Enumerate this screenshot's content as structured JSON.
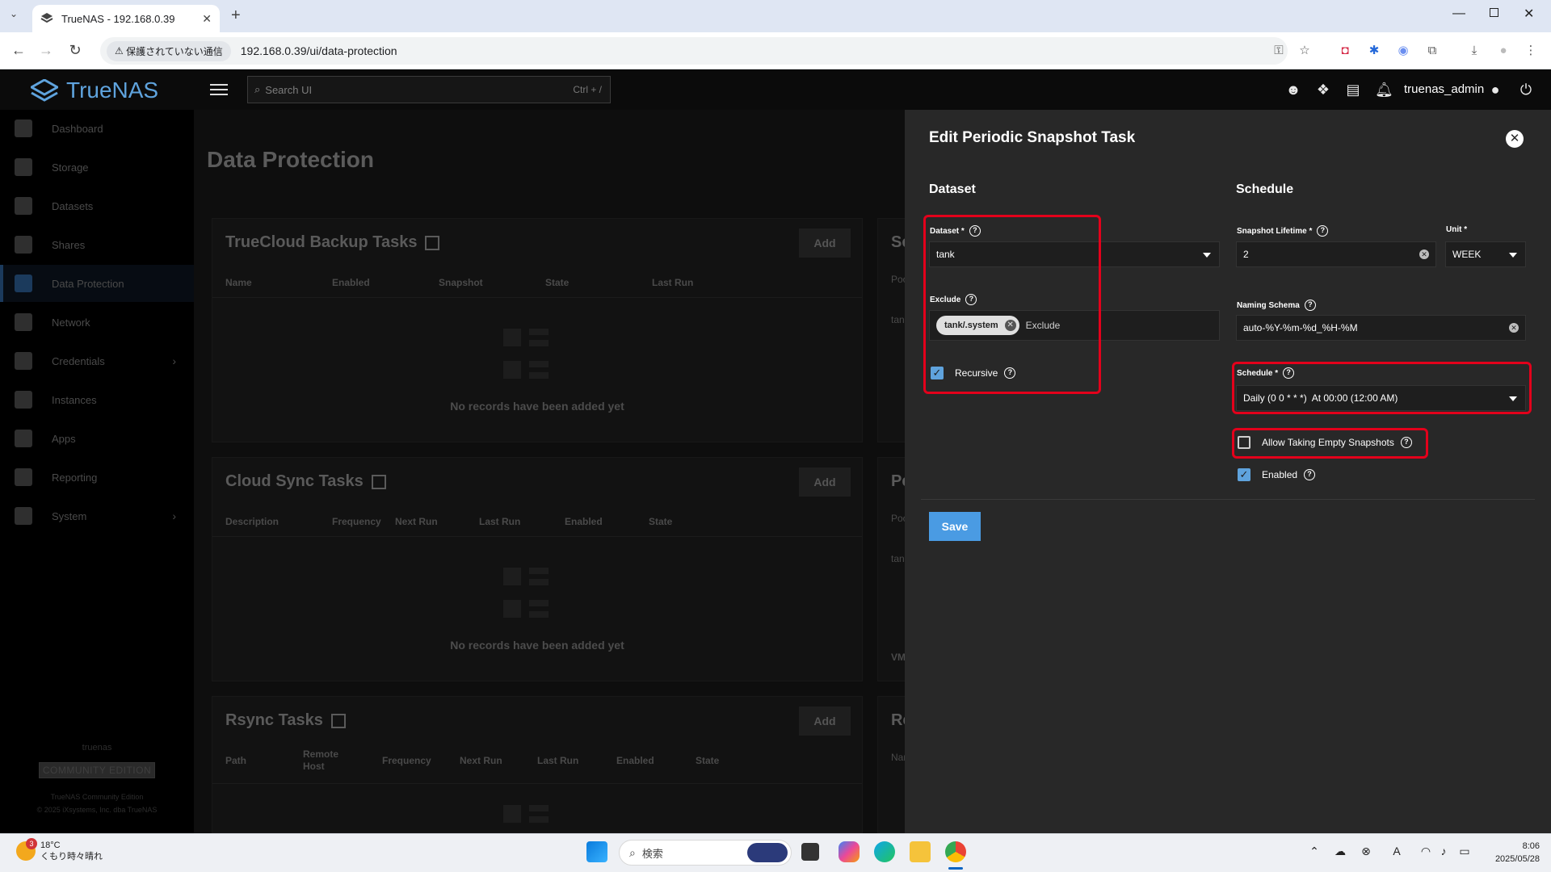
{
  "browser": {
    "tab_title": "TrueNAS - 192.168.0.39",
    "security_warning": "保護されていない通信",
    "url": "192.168.0.39/ui/data-protection"
  },
  "header": {
    "logo_text": "TrueNAS",
    "search_placeholder": "Search UI",
    "search_shortcut": "Ctrl + /",
    "username": "truenas_admin"
  },
  "sidebar": {
    "items": [
      {
        "label": "Dashboard"
      },
      {
        "label": "Storage"
      },
      {
        "label": "Datasets"
      },
      {
        "label": "Shares"
      },
      {
        "label": "Data Protection"
      },
      {
        "label": "Network"
      },
      {
        "label": "Credentials"
      },
      {
        "label": "Instances"
      },
      {
        "label": "Apps"
      },
      {
        "label": "Reporting"
      },
      {
        "label": "System"
      }
    ],
    "hostname": "truenas",
    "edition": "COMMUNITY EDITION",
    "version": "TrueNAS Community Edition",
    "copyright": "© 2025 iXsystems, Inc. dba TrueNAS"
  },
  "main": {
    "page_title": "Data Protection",
    "cards": [
      {
        "title": "TrueCloud Backup Tasks",
        "add_label": "Add",
        "columns": [
          "Name",
          "Enabled",
          "Snapshot",
          "State",
          "Last Run"
        ],
        "empty_text": "No records have been added yet"
      },
      {
        "title": "Cloud Sync Tasks",
        "add_label": "Add",
        "columns": [
          "Description",
          "Frequency",
          "Next Run",
          "Last Run",
          "Enabled",
          "State"
        ],
        "empty_text": "No records have been added yet"
      },
      {
        "title": "Rsync Tasks",
        "add_label": "Add",
        "columns": [
          "Path",
          "Remote Host",
          "Frequency",
          "Next Run",
          "Last Run",
          "Enabled",
          "State"
        ]
      }
    ],
    "right_cards": [
      {
        "title": "Sc",
        "sub": "Poo",
        "sub2": "tan"
      },
      {
        "title": "Pe",
        "sub": "Poo",
        "sub2": "tan",
        "sub3": "VM"
      },
      {
        "title": "Re",
        "sub": "Nar"
      }
    ]
  },
  "drawer": {
    "title": "Edit Periodic Snapshot Task",
    "dataset_section": "Dataset",
    "schedule_section": "Schedule",
    "dataset_label": "Dataset *",
    "dataset_value": "tank",
    "exclude_label": "Exclude",
    "exclude_chip": "tank/.system",
    "exclude_placeholder": "Exclude",
    "recursive_label": "Recursive",
    "recursive_checked": true,
    "lifetime_label": "Snapshot Lifetime *",
    "lifetime_value": "2",
    "unit_label": "Unit *",
    "unit_value": "WEEK",
    "naming_label": "Naming Schema",
    "naming_value": "auto-%Y-%m-%d_%H-%M",
    "schedule_label": "Schedule *",
    "schedule_value": "Daily (0 0 * * *)  At 00:00 (12:00 AM)",
    "empty_snapshots_label": "Allow Taking Empty Snapshots",
    "empty_snapshots_checked": false,
    "enabled_label": "Enabled",
    "enabled_checked": true,
    "save_label": "Save",
    "highlight_color": "#e3001b"
  },
  "taskbar": {
    "weather_temp": "18°C",
    "weather_text": "くもり時々晴れ",
    "weather_badge": "3",
    "search_placeholder": "検索",
    "time": "8:06",
    "date": "2025/05/28"
  }
}
